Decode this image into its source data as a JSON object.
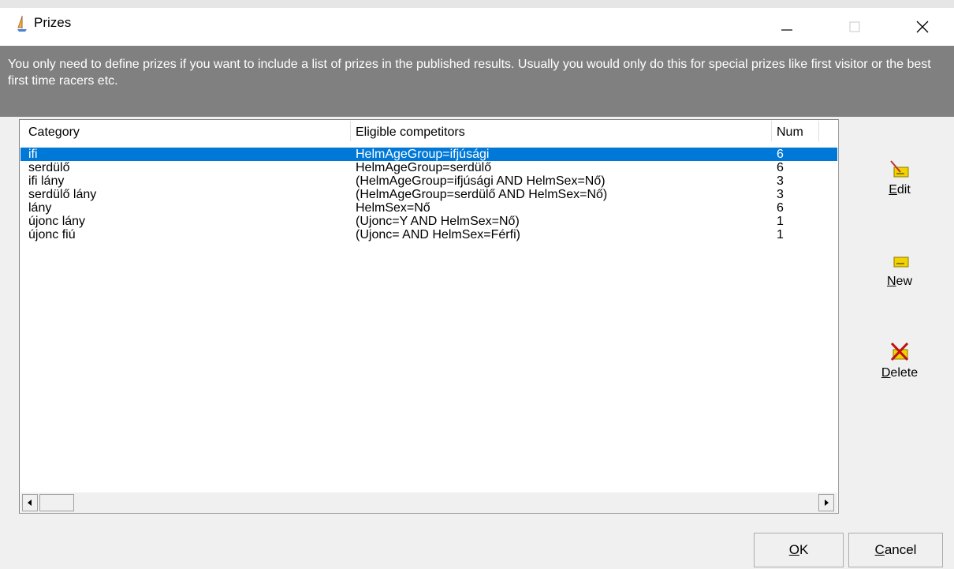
{
  "window": {
    "title": "Prizes",
    "minimize_icon": "minimize-icon",
    "maximize_icon": "maximize-icon",
    "close_icon": "close-icon"
  },
  "info": {
    "text": "You only need to define prizes if you  want to include a list of prizes in the published results.  Usually you would only do this for special prizes like first visitor or the best first time racers etc."
  },
  "table": {
    "columns": [
      "Category",
      "Eligible competitors",
      "Num"
    ],
    "rows": [
      {
        "category": "ifi",
        "eligible": "HelmAgeGroup=ifjúsági",
        "num": "6",
        "selected": true
      },
      {
        "category": "serdülő",
        "eligible": "HelmAgeGroup=serdülő",
        "num": "6"
      },
      {
        "category": "ifi lány",
        "eligible": "(HelmAgeGroup=ifjúsági AND HelmSex=Nő)",
        "num": "3"
      },
      {
        "category": "serdülő lány",
        "eligible": "(HelmAgeGroup=serdülő AND HelmSex=Nő)",
        "num": "3"
      },
      {
        "category": "lány",
        "eligible": "HelmSex=Nő",
        "num": "6"
      },
      {
        "category": "újonc lány",
        "eligible": "(Ujonc=Y AND HelmSex=Nő)",
        "num": "1"
      },
      {
        "category": "újonc fiú",
        "eligible": "(Ujonc= AND HelmSex=Férfi)",
        "num": "1"
      }
    ]
  },
  "actions": {
    "edit": {
      "first": "E",
      "rest": "dit"
    },
    "new": {
      "first": "N",
      "rest": "ew"
    },
    "delete": {
      "first": "D",
      "rest": "elete"
    }
  },
  "buttons": {
    "ok": {
      "first": "O",
      "rest": "K"
    },
    "cancel": {
      "first": "C",
      "rest": "ancel"
    }
  },
  "colors": {
    "selection": "#0078d7",
    "info_bg": "#808080"
  }
}
